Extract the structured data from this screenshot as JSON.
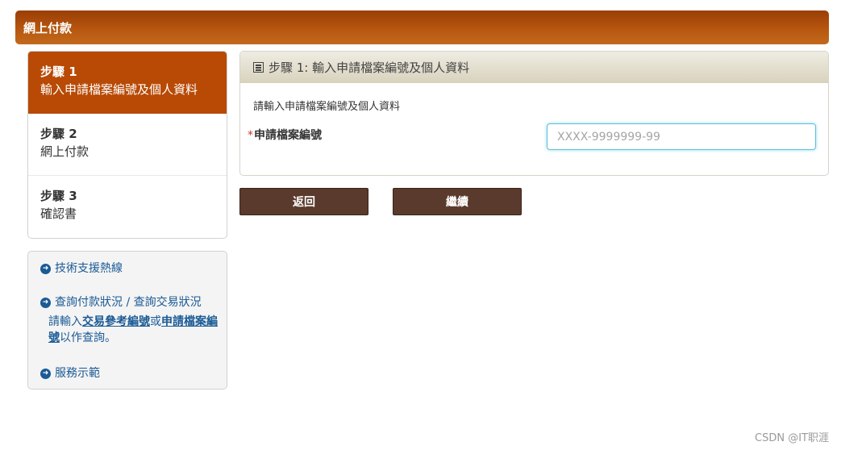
{
  "header": {
    "title": "網上付款"
  },
  "steps": [
    {
      "num": "步驟 1",
      "label": "輸入申請檔案編號及個人資料",
      "active": true
    },
    {
      "num": "步驟 2",
      "label": "網上付款",
      "active": false
    },
    {
      "num": "步驟 3",
      "label": "確認書",
      "active": false
    }
  ],
  "links": {
    "support": "技術支援熱線",
    "query": "查詢付款狀況 / 查詢交易狀況",
    "query_desc_prefix": "請輸入",
    "query_desc_link1": "交易參考編號",
    "query_desc_mid": "或",
    "query_desc_link2": "申請檔案編號",
    "query_desc_suffix": "以作查詢。",
    "demo": "服務示範"
  },
  "panel": {
    "title": "步驟 1: 輸入申請檔案編號及個人資料",
    "instruction": "請輸入申請檔案編號及個人資料",
    "required_mark": "*",
    "field_label": "申請檔案編號",
    "field_placeholder": "XXXX-9999999-99",
    "field_value": ""
  },
  "buttons": {
    "back": "返回",
    "next": "繼續"
  },
  "watermark": "CSDN @IT职涯",
  "colors": {
    "accent": "#b84a05",
    "button": "#5a3a2c",
    "link": "#1a5a95"
  }
}
